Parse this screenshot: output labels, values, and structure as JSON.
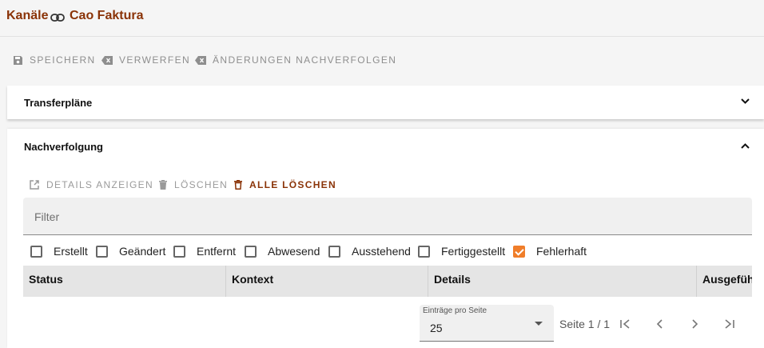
{
  "header": {
    "crumb": "Kanäle",
    "link_icon": "link-icon",
    "title": "Cao Faktura"
  },
  "toolbar": {
    "save": "SPEICHERN",
    "discard": "VERWERFEN",
    "track": "ÄNDERUNGEN NACHVERFOLGEN"
  },
  "panels": {
    "transfer": "Transferpläne",
    "tracking": "Nachverfolgung"
  },
  "actions": {
    "details": "DETAILS ANZEIGEN",
    "delete": "LÖSCHEN",
    "delete_all": "ALLE LÖSCHEN"
  },
  "filter": {
    "label": "Filter"
  },
  "status_filters": [
    {
      "label": "Erstellt",
      "checked": false
    },
    {
      "label": "Geändert",
      "checked": false
    },
    {
      "label": "Entfernt",
      "checked": false
    },
    {
      "label": "Abwesend",
      "checked": false
    },
    {
      "label": "Ausstehend",
      "checked": false
    },
    {
      "label": "Fertiggestellt",
      "checked": false
    },
    {
      "label": "Fehlerhaft",
      "checked": true
    }
  ],
  "table": {
    "columns": [
      "Status",
      "Kontext",
      "Details",
      "Ausgeführt"
    ]
  },
  "pagination": {
    "per_page_label": "Einträge pro Seite",
    "per_page_value": "25",
    "page_info": "Seite 1 / 1"
  },
  "colors": {
    "brand": "#8a3307",
    "accent": "#f07e2a"
  }
}
